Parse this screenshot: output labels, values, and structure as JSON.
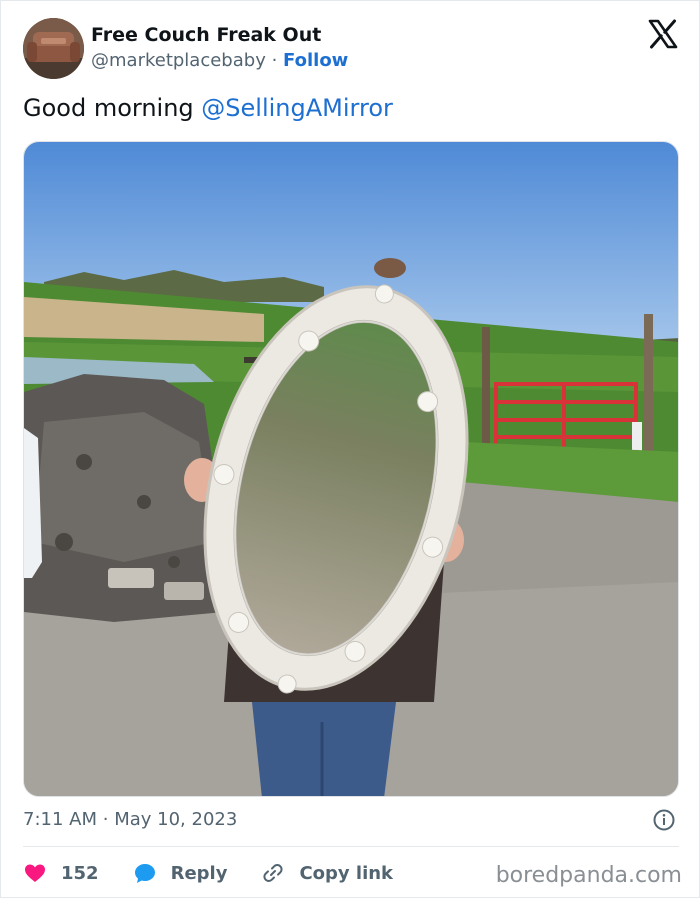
{
  "author": {
    "display_name": "Free Couch Freak Out",
    "handle": "@marketplacebaby",
    "separator": "·",
    "follow_label": "Follow"
  },
  "tweet": {
    "text": "Good morning ",
    "mention": "@SellingAMirror"
  },
  "timestamp": {
    "time": "7:11 AM",
    "separator": "·",
    "date": "May 10, 2023"
  },
  "actions": {
    "like_count": "152",
    "reply_label": "Reply",
    "copy_link_label": "Copy link"
  },
  "watermark": "boredpanda.com",
  "icons": {
    "brand": "x-logo-icon",
    "info": "info-icon",
    "like": "heart-icon",
    "reply": "speech-bubble-icon",
    "copy": "link-icon"
  },
  "colors": {
    "link": "#1d6fd1",
    "like": "#f91880",
    "reply": "#1d9bf0",
    "secondary_text": "#536471"
  }
}
